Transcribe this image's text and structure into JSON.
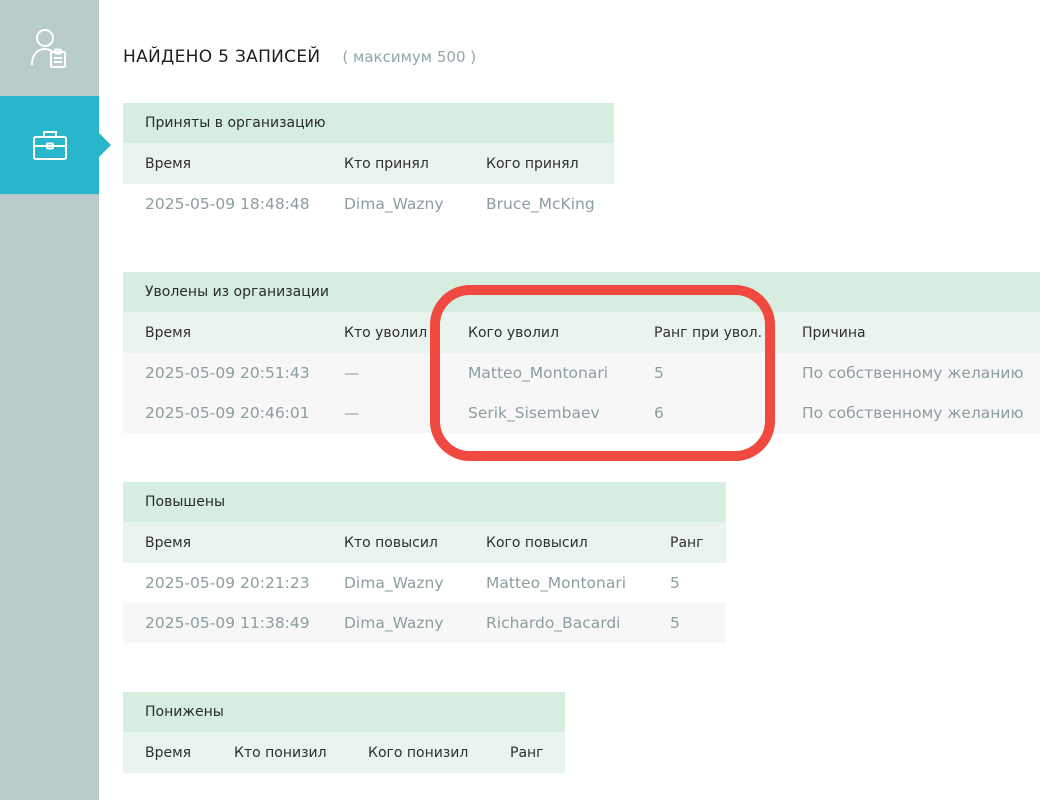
{
  "sidebar": {
    "items": [
      {
        "name": "user-clipboard-icon",
        "active": false
      },
      {
        "name": "briefcase-icon",
        "active": true
      }
    ]
  },
  "header": {
    "title": "НАЙДЕНО 5 ЗАПИСЕЙ",
    "subtitle": "( максимум 500 )"
  },
  "hired": {
    "caption": "Приняты в организацию",
    "columns": [
      "Время",
      "Кто принял",
      "Кого принял"
    ],
    "rows": [
      [
        "2025-05-09 18:48:48",
        "Dima_Wazny",
        "Bruce_McKing"
      ]
    ]
  },
  "fired": {
    "caption": "Уволены из организации",
    "columns": [
      "Время",
      "Кто уволил",
      "Кого уволил",
      "Ранг при увол.",
      "Причина"
    ],
    "rows": [
      [
        "2025-05-09 20:51:43",
        "—",
        "Matteo_Montonari",
        "5",
        "По собственному желанию"
      ],
      [
        "2025-05-09 20:46:01",
        "—",
        "Serik_Sisembaev",
        "6",
        "По собственному желанию"
      ]
    ]
  },
  "promoted": {
    "caption": "Повышены",
    "columns": [
      "Время",
      "Кто повысил",
      "Кого повысил",
      "Ранг"
    ],
    "rows": [
      [
        "2025-05-09 20:21:23",
        "Dima_Wazny",
        "Matteo_Montonari",
        "5"
      ],
      [
        "2025-05-09 11:38:49",
        "Dima_Wazny",
        "Richardo_Bacardi",
        "5"
      ]
    ]
  },
  "demoted": {
    "caption": "Понижены",
    "columns": [
      "Время",
      "Кто понизил",
      "Кого понизил",
      "Ранг"
    ],
    "rows": []
  },
  "colors": {
    "sidebar_bg": "#b9cccb",
    "active_accent": "#29b6cc",
    "caption_bg": "#d6eee0",
    "header_bg": "#eaf4ee",
    "highlight": "#f0493f"
  }
}
